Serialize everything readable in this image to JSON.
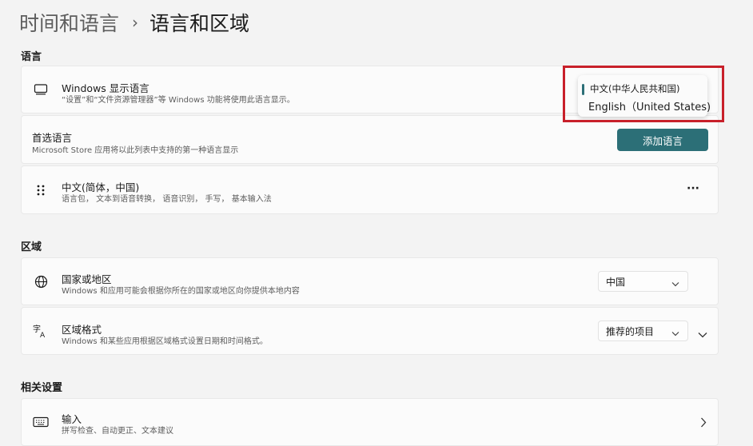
{
  "header": {
    "parent": "时间和语言",
    "current": "语言和区域"
  },
  "language_section": {
    "title": "语言",
    "display_language": {
      "title": "Windows 显示语言",
      "subtitle": "“设置”和“文件资源管理器”等 Windows 功能将使用此语言显示。",
      "options": [
        "中文(中华人民共和国)",
        "English（United States)"
      ],
      "selected_index": 0
    },
    "preferred": {
      "title": "首选语言",
      "subtitle": "Microsoft Store 应用将以此列表中支持的第一种语言显示",
      "button": "添加语言"
    },
    "installed": {
      "title": "中文(简体，中国)",
      "subtitle": "语言包， 文本到语音转换， 语音识别， 手写， 基本输入法",
      "more": "···"
    }
  },
  "region_section": {
    "title": "区域",
    "country": {
      "title": "国家或地区",
      "subtitle": "Windows 和应用可能会根据你所在的国家或地区向你提供本地内容",
      "value": "中国"
    },
    "format": {
      "title": "区域格式",
      "subtitle": "Windows 和某些应用根据区域格式设置日期和时间格式。",
      "value": "推荐的项目"
    }
  },
  "related_section": {
    "title": "相关设置",
    "input": {
      "title": "输入",
      "subtitle": "拼写检查、自动更正、文本建议"
    }
  },
  "colors": {
    "accent": "#2c6f77",
    "highlight": "#c8202a",
    "background": "#f3f3f3",
    "card": "#fbfbfb"
  }
}
